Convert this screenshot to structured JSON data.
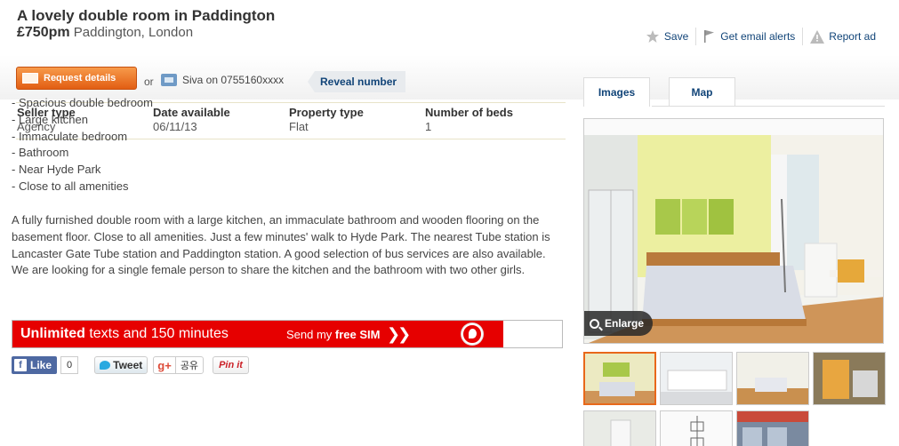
{
  "header": {
    "title": "A lovely double room in Paddington",
    "price": "£750pm",
    "location": "Paddington, London"
  },
  "actions": {
    "save": "Save",
    "email_alerts": "Get email alerts",
    "report": "Report ad"
  },
  "contact": {
    "request_label": "Request details",
    "or": "or",
    "phone_text": "Siva on 0755160xxxx",
    "reveal_label": "Reveal number"
  },
  "meta": [
    {
      "label": "Seller type",
      "value": "Agency"
    },
    {
      "label": "Date available",
      "value": "06/11/13"
    },
    {
      "label": "Property type",
      "value": "Flat"
    },
    {
      "label": "Number of beds",
      "value": "1"
    }
  ],
  "features": [
    "- Spacious double bedroom",
    "- Large kitchen",
    "- Immaculate bedroom",
    "- Bathroom",
    "- Near Hyde Park",
    "- Close to all amenities"
  ],
  "description": {
    "p1": "A fully furnished double room with a large kitchen, an immaculate bathroom and wooden flooring on the basement floor. Close to all amenities. Just a few minutes' walk to Hyde Park. The nearest Tube station is Lancaster Gate Tube station and Paddington station. A good selection of bus services are also available.",
    "p2": "We are looking for a single female person to share the kitchen and the bathroom with two other girls."
  },
  "banner": {
    "bold1": "Unlimited",
    "text1": " texts and 150 minutes",
    "text2": "Send my ",
    "bold2": "free SIM",
    "arrows": "❯❯"
  },
  "social": {
    "fb_like": "Like",
    "fb_count": "0",
    "tweet": "Tweet",
    "gplus": "g+",
    "gplus_label": "공유",
    "pinit": "Pin it"
  },
  "tabs": {
    "images": "Images",
    "map": "Map"
  },
  "photo": {
    "enlarge": "Enlarge"
  },
  "colors": {
    "link": "#114478",
    "accent_orange": "#e25e13",
    "vodafone_red": "#e60000"
  }
}
